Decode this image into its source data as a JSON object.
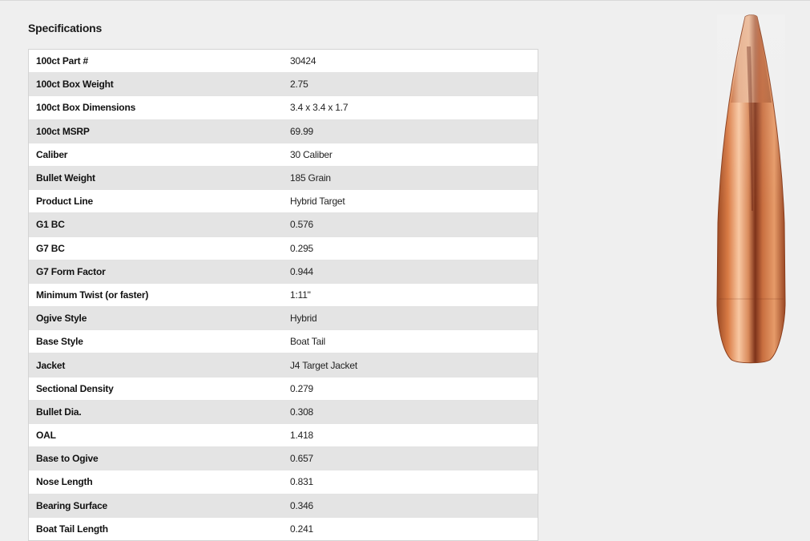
{
  "page": {
    "section_title": "Specifications"
  },
  "specs": [
    {
      "label": "100ct Part #",
      "value": "30424"
    },
    {
      "label": "100ct Box Weight",
      "value": "2.75"
    },
    {
      "label": "100ct Box Dimensions",
      "value": "3.4 x 3.4 x 1.7"
    },
    {
      "label": "100ct MSRP",
      "value": "69.99"
    },
    {
      "label": "Caliber",
      "value": "30 Caliber"
    },
    {
      "label": "Bullet Weight",
      "value": "185 Grain"
    },
    {
      "label": "Product Line",
      "value": "Hybrid Target"
    },
    {
      "label": "G1 BC",
      "value": "0.576"
    },
    {
      "label": "G7 BC",
      "value": "0.295"
    },
    {
      "label": "G7 Form Factor",
      "value": "0.944"
    },
    {
      "label": "Minimum Twist (or faster)",
      "value": "1:11\""
    },
    {
      "label": "Ogive Style",
      "value": "Hybrid"
    },
    {
      "label": "Base Style",
      "value": "Boat Tail"
    },
    {
      "label": "Jacket",
      "value": "J4 Target Jacket"
    },
    {
      "label": "Sectional Density",
      "value": "0.279"
    },
    {
      "label": "Bullet Dia.",
      "value": "0.308"
    },
    {
      "label": "OAL",
      "value": "1.418"
    },
    {
      "label": "Base to Ogive",
      "value": "0.657"
    },
    {
      "label": "Nose Length",
      "value": "0.831"
    },
    {
      "label": "Bearing Surface",
      "value": "0.346"
    },
    {
      "label": "Boat Tail Length",
      "value": "0.241"
    }
  ],
  "product_image": {
    "icon": "bullet-image",
    "colors": {
      "copper_light": "#f4c29b",
      "copper_mid": "#d9824f",
      "copper_dark": "#8b3f1d"
    }
  }
}
